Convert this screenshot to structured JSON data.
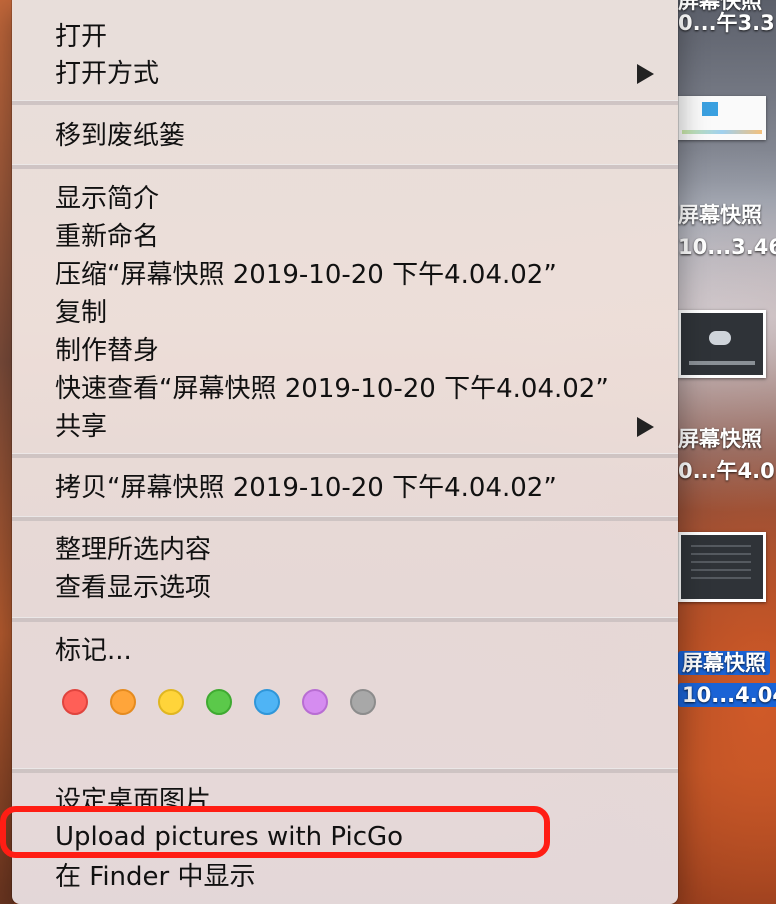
{
  "desktop": {
    "labels": [
      {
        "text": "0...午3.3"
      },
      {
        "text": "屏幕快照"
      },
      {
        "text": "10...3.46"
      },
      {
        "text": "屏幕快照"
      },
      {
        "text": "0...午4.0"
      },
      {
        "text": "屏幕快照"
      },
      {
        "text": "10...4.04"
      }
    ],
    "partial_top_label": "屏幕快照"
  },
  "menu": {
    "items": {
      "open": "打开",
      "open_with": "打开方式",
      "move_to_trash": "移到废纸篓",
      "get_info": "显示简介",
      "rename": "重新命名",
      "compress": "压缩“屏幕快照 2019-10-20 下午4.04.02”",
      "duplicate": "复制",
      "make_alias": "制作替身",
      "quick_look": "快速查看“屏幕快照 2019-10-20 下午4.04.02”",
      "share": "共享",
      "copy": "拷贝“屏幕快照 2019-10-20 下午4.04.02”",
      "clean_up": "整理所选内容",
      "show_view_options": "查看显示选项",
      "tags": "标记...",
      "set_desktop_picture": "设定桌面图片",
      "upload_picgo": "Upload pictures with PicGo",
      "show_in_finder": "在 Finder 中显示"
    },
    "tag_colors": [
      {
        "name": "red",
        "fill": "#ff5f57",
        "stroke": "#e0443e"
      },
      {
        "name": "orange",
        "fill": "#ffa53a",
        "stroke": "#e58b1f"
      },
      {
        "name": "yellow",
        "fill": "#ffd43a",
        "stroke": "#e0b620"
      },
      {
        "name": "green",
        "fill": "#5bc94a",
        "stroke": "#3faa31"
      },
      {
        "name": "blue",
        "fill": "#4fb4f5",
        "stroke": "#2f96d9"
      },
      {
        "name": "purple",
        "fill": "#d58cf0",
        "stroke": "#b86dd3"
      },
      {
        "name": "gray",
        "fill": "#a8a8a8",
        "stroke": "#8c8c8c"
      }
    ],
    "highlight_color": "#ff1d14"
  }
}
